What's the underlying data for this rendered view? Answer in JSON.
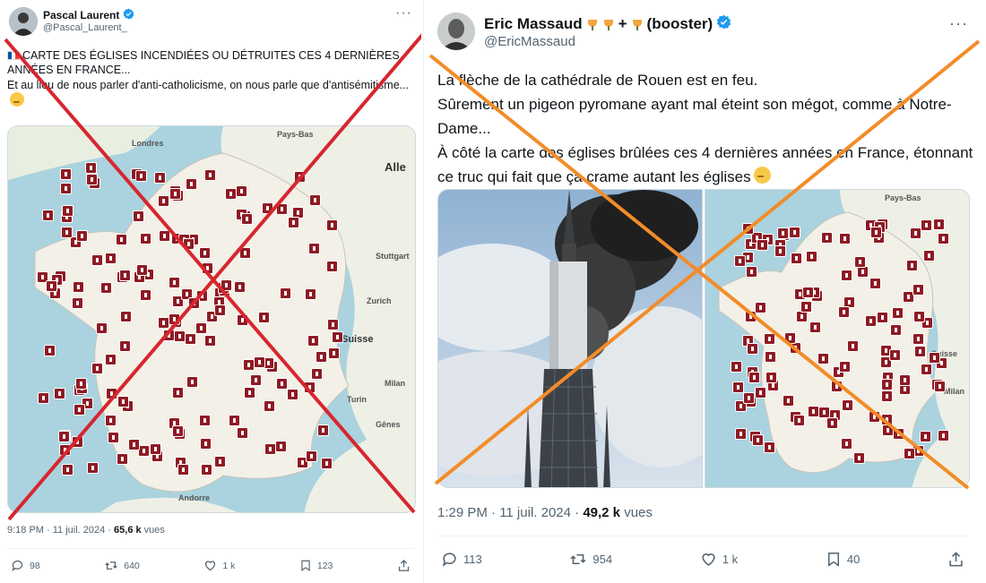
{
  "tweet1": {
    "author_name": "Pascal Laurent",
    "handle": "@Pascal_Laurent_",
    "text_line1": "CARTE DES ÉGLISES INCENDIÉES OU DÉTRUITES CES 4 DERNIÈRES ANNÉES EN FRANCE...",
    "text_line2": "Et au lieu de nous parler d'anti-catholicisme, on nous parle que d'antisémitisme...",
    "map_labels": [
      "Londres",
      "Pays-Bas",
      "Alle",
      "Suisse",
      "Milan",
      "Turin",
      "Gênes",
      "Andorre",
      "Stuttgart",
      "Zurich"
    ],
    "timestamp": "9:18 PM · 11 juil. 2024 · ",
    "views": "65,6 k",
    "views_suffix": " vues",
    "replies": "98",
    "reposts": "640",
    "likes": "1 k",
    "bookmarks": "123",
    "cross_color": "#d7262e"
  },
  "tweet2": {
    "author_name": "Eric Massaud",
    "name_suffix": "+",
    "name_suffix2": "(booster)",
    "handle": "@EricMassaud",
    "line1": "La flèche de la cathédrale de Rouen est en feu.",
    "line2": "Sûrement un pigeon pyromane ayant mal éteint son mégot, comme à Notre-Dame...",
    "line3": "À côté la carte des églises brûlées ces 4 dernières années en France, étonnant ce truc qui fait que ça crame autant les églises",
    "map_labels": [
      "Pays-Bas",
      "Suisse",
      "Milan"
    ],
    "timestamp": "1:29 PM · 11 juil. 2024 · ",
    "views": "49,2 k",
    "views_suffix": " vues",
    "replies": "113",
    "reposts": "954",
    "likes": "1 k",
    "bookmarks": "40",
    "cross_color": "#f28c28"
  },
  "icons": [
    "verified-icon",
    "more-icon",
    "reply-icon",
    "repost-icon",
    "like-icon",
    "bookmark-icon",
    "share-icon"
  ],
  "accent_color": "#1d9bf0"
}
